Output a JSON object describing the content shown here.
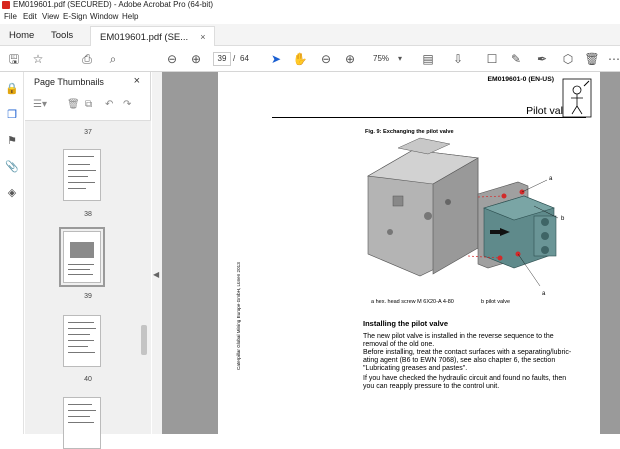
{
  "window": {
    "title": "EM019601.pdf (SECURED) - Adobe Acrobat Pro (64-bit)"
  },
  "menu": [
    "File",
    "Edit",
    "View",
    "E-Sign",
    "Window",
    "Help"
  ],
  "tabs": {
    "home": "Home",
    "tools": "Tools",
    "doc": "EM019601.pdf (SE...",
    "close": "×"
  },
  "toolbar": {
    "page_current": "39",
    "page_sep": "/",
    "page_total": "64",
    "zoom": "75%"
  },
  "panel": {
    "title": "Page Thumbnails",
    "close": "×"
  },
  "thumbnails": [
    {
      "label": "37"
    },
    {
      "label": "38"
    },
    {
      "label": "39",
      "selected": true
    },
    {
      "label": "40"
    }
  ],
  "page": {
    "doc_id": "EM019601-0 (EN-US)",
    "section_title": "Pilot valve",
    "figure_caption": "Fig. 9:      Exchanging the pilot valve",
    "callout_a1": "a",
    "callout_b": "b",
    "callout_a2": "a",
    "legend_a": "a   hex. head screw M 6X20-A 4-80",
    "legend_b": "b   pilot valve",
    "side_text": "Caterpillar Global Mining Europe GmbH, Lünen 2013",
    "heading": "Installing the pilot valve",
    "para1": "The new pilot valve is installed in the reverse sequence to the\nremoval of the old one.\nBefore installing, treat the contact surfaces with a separating/lubric-\nating agent (B6 to EWN 7068), see also chapter 6, the section\n\"Lubricating greases and pastes\".",
    "para2": "If you have checked the hydraulic circuit and found no faults, then\nyou can reapply pressure to the control unit."
  }
}
